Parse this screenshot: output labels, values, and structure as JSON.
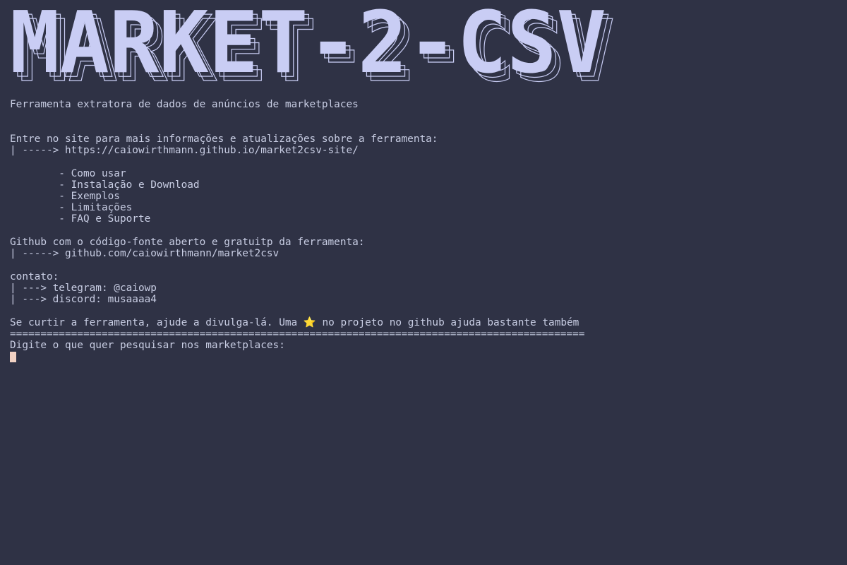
{
  "banner": {
    "text": "MARKET-2-CSV",
    "fill_color": "#c9cdf4",
    "outline_color": "#c9cdf4"
  },
  "subtitle": "Ferramenta extratora de dados de anúncios de marketplaces",
  "site": {
    "intro": "Entre no site para mais informações e atualizações sobre a ferramenta:",
    "link": "| -----> https://caiowirthmann.github.io/market2csv-site/"
  },
  "site_items": [
    "        - Como usar",
    "        - Instalação e Download",
    "        - Exemplos",
    "        - Limitações",
    "        - FAQ e Suporte"
  ],
  "github": {
    "intro": "Github com o código-fonte aberto e gratuitp da ferramenta:",
    "link": "| -----> github.com/caiowirthmann/market2csv"
  },
  "contact": {
    "label": "contato:",
    "telegram": "| ---> telegram: @caiowp",
    "discord": "| ---> discord: musaaaa4"
  },
  "support": {
    "before": "Se curtir a ferramenta, ajude a divulga-lá. Uma ",
    "star_icon": "⭐",
    "after": " no projeto no github ajuda bastante também"
  },
  "separator": "==============================================================================================",
  "prompt": "Digite o que quer pesquisar nos marketplaces:",
  "colors": {
    "background": "#2f3245",
    "text": "#c8cde3",
    "cursor": "#f2d2c4",
    "star": "#f7c41a"
  }
}
